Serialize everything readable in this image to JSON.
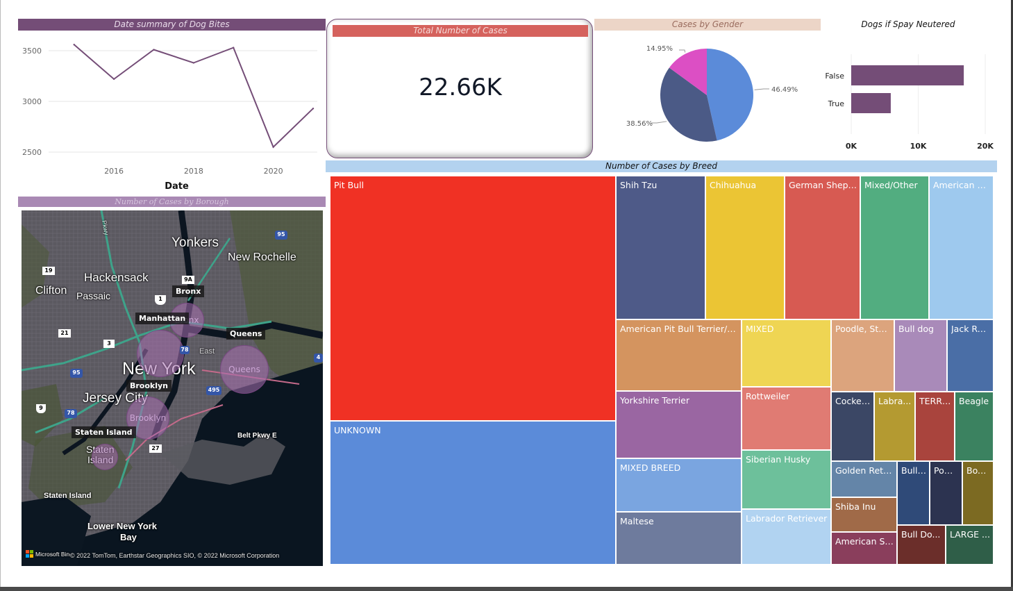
{
  "colors": {
    "purple": "#744d77",
    "red_header": "#d5625d",
    "gender_header": "#ecd5c7",
    "breed_header": "#b3d2ef",
    "borough_header": "#a989b4"
  },
  "line_panel": {
    "title": "Date summary of Dog Bites",
    "chart_data": {
      "type": "line",
      "x": [
        2015,
        2016,
        2017,
        2018,
        2019,
        2020,
        2021
      ],
      "series": [
        {
          "values": [
            3560,
            3220,
            3510,
            3380,
            3530,
            2550,
            2930
          ]
        }
      ],
      "xticks": [
        "2016",
        "2018",
        "2020"
      ],
      "yticks": [
        "3500",
        "3000",
        "2500"
      ],
      "xlim": [
        2014.5,
        2021
      ],
      "ylim": [
        2500,
        3500
      ],
      "xlabel": "Date",
      "ylabel": "",
      "grid": true
    }
  },
  "card": {
    "title": "Total Number of Cases",
    "value": "22.66K"
  },
  "pie_panel": {
    "title": "Cases by Gender",
    "chart_data": {
      "type": "pie",
      "values": [
        46.49,
        38.56,
        14.95
      ],
      "labels": [
        "46.49%",
        "38.56%",
        "14.95%"
      ],
      "colors": [
        "#5b8bd9",
        "#4b5a86",
        "#dc4fc4"
      ]
    }
  },
  "bar_panel": {
    "title": "Dogs if Spay Neutered",
    "chart_data": {
      "type": "bar",
      "categories": [
        "False",
        "True"
      ],
      "values": [
        16800,
        5900
      ],
      "xticks": [
        "0K",
        "10K",
        "20K"
      ],
      "xlim": [
        0,
        20000
      ],
      "color": "#744d77"
    }
  },
  "map_panel": {
    "title": "Number of Cases by Borough",
    "place_labels": [
      "Yonkers",
      "New Rochelle",
      "Hackensack",
      "Clifton",
      "Passaic",
      "New York",
      "Jersey City",
      "Belt Pkwy E",
      "Staten Island",
      "Lower New York",
      "Bay",
      "East",
      "Staten",
      "Island",
      "Pkwy"
    ],
    "bubbles": [
      "Bronx",
      "Manhattan",
      "Queens",
      "Brooklyn",
      "Staten Island"
    ],
    "badges": [
      "Bronx",
      "Manhattan",
      "Queens",
      "Brooklyn",
      "Staten Island"
    ],
    "shields": [
      "95",
      "19",
      "9A",
      "1",
      "21",
      "3",
      "95",
      "78",
      "495",
      "9",
      "78",
      "27",
      "4"
    ],
    "brand": "Microsoft Bing",
    "attribution": "© 2022 TomTom, Earthstar Geographics SIO, © 2022 Microsoft Corporation"
  },
  "treemap_panel": {
    "title": "Number of Cases by Breed",
    "chart_data": {
      "type": "treemap",
      "tiles": [
        {
          "label": "Pit Bull",
          "color": "#f03124"
        },
        {
          "label": "UNKNOWN",
          "color": "#5b8bd9"
        },
        {
          "label": "Shih Tzu",
          "color": "#4e5a88"
        },
        {
          "label": "Chihuahua",
          "color": "#ebc534"
        },
        {
          "label": "German Sheph...",
          "color": "#d75a52"
        },
        {
          "label": "Mixed/Other",
          "color": "#52ad80"
        },
        {
          "label": "American Pi...",
          "color": "#9ec9ee"
        },
        {
          "label": "American Pit Bull Terrier/Pit...",
          "color": "#d4945f"
        },
        {
          "label": "MIXED",
          "color": "#efd553"
        },
        {
          "label": "Poodle, Sta...",
          "color": "#dca47d"
        },
        {
          "label": "Bull dog",
          "color": "#a98ab9"
        },
        {
          "label": "Jack Russ",
          "color": "#4a6ea6"
        },
        {
          "label": "Yorkshire Terrier",
          "color": "#9a66a2"
        },
        {
          "label": "Rottweiler",
          "color": "#e07b73"
        },
        {
          "label": "Cocker...",
          "color": "#3b4765"
        },
        {
          "label": "Labra...",
          "color": "#b49a31"
        },
        {
          "label": "TERRI...",
          "color": "#a9443d"
        },
        {
          "label": "Beagle",
          "color": "#3b8260"
        },
        {
          "label": "MIXED BREED",
          "color": "#7aa5e0"
        },
        {
          "label": "Siberian Husky",
          "color": "#6dc09b"
        },
        {
          "label": "Golden Retri...",
          "color": "#6485a8"
        },
        {
          "label": "Bull ...",
          "color": "#2f4a78"
        },
        {
          "label": "Pom...",
          "color": "#2c3350"
        },
        {
          "label": "Boxer",
          "color": "#7c6a22"
        },
        {
          "label": "Maltese",
          "color": "#6e7b9d"
        },
        {
          "label": "Labrador Retriever",
          "color": "#b1d3f1"
        },
        {
          "label": "Shiba Inu",
          "color": "#a06a48"
        },
        {
          "label": "American St...",
          "color": "#8a3e5c"
        },
        {
          "label": "Bull Do...",
          "color": "#6b2e2a"
        },
        {
          "label": "LARGE ...",
          "color": "#2f5e48"
        }
      ]
    }
  }
}
